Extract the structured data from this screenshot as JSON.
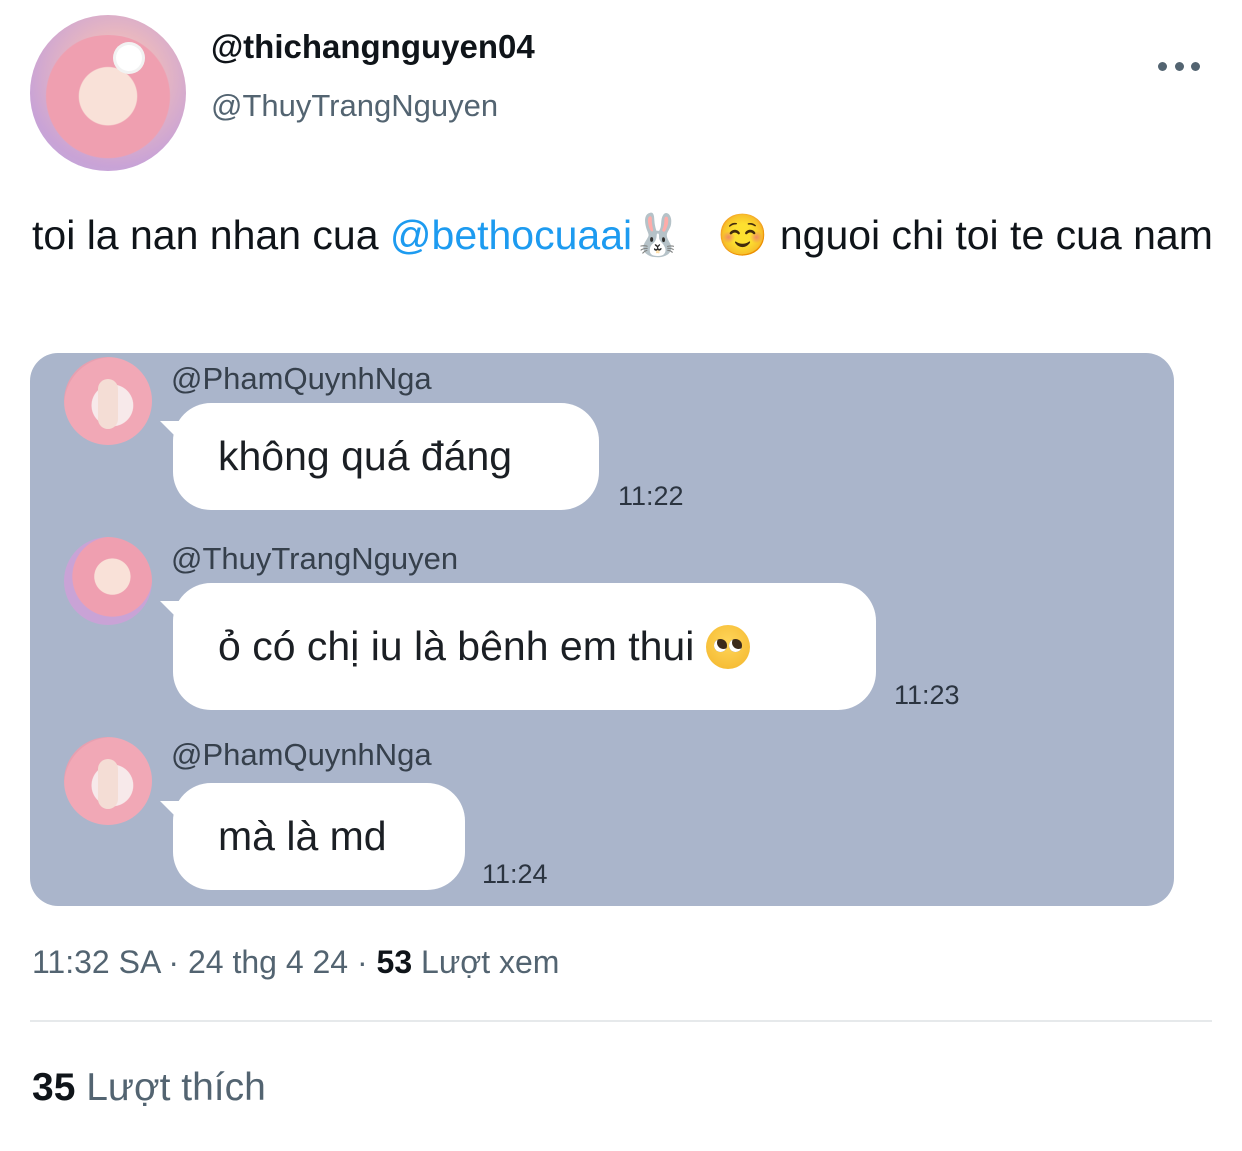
{
  "author": {
    "display_name": "@thichangnguyen04",
    "handle": "@ThuyTrangNguyen",
    "avatar_icon": "profile-photo"
  },
  "tweet": {
    "text_part1": "toi la nan nhan cua ",
    "mention": "@bethocuaai",
    "emoji1": "🐰",
    "emoji2": "☺️",
    "text_part2": "  nguoi chi toi te cua nam"
  },
  "chat": {
    "messages": [
      {
        "sender": "@PhamQuynhNga",
        "text": "không quá đáng",
        "time": "11:22"
      },
      {
        "sender": "@ThuyTrangNguyen",
        "text": "ỏ có chị iu là bênh em thui",
        "emoji": "pleading-face",
        "time": "11:23"
      },
      {
        "sender": "@PhamQuynhNga",
        "text": "mà là md",
        "time": "11:24"
      }
    ],
    "background_color": "#aab5cb"
  },
  "meta": {
    "time": "11:32 SA",
    "date": "24 thg 4 24",
    "separator": "·",
    "views_count": "53",
    "views_label": "Lượt xem"
  },
  "stats": {
    "likes_count": "35",
    "likes_label": "Lượt thích"
  },
  "colors": {
    "link": "#1d9bf0",
    "secondary_text": "#536471",
    "primary_text": "#0f1419"
  }
}
